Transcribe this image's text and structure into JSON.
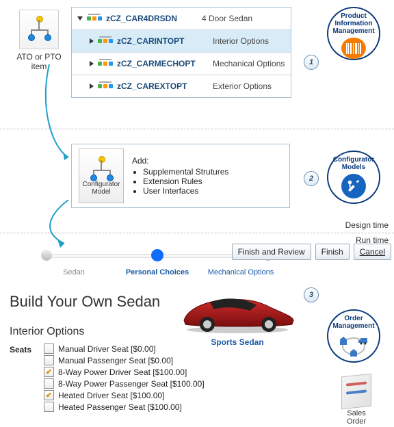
{
  "ato_label": "ATO or PTO\nitem",
  "item_tree": {
    "rows": [
      {
        "code": "zCZ_CAR4DRSDN",
        "desc": "4 Door Sedan",
        "expanded": true,
        "selected": false
      },
      {
        "code": "zCZ_CARINTOPT",
        "desc": "Interior Options",
        "expanded": false,
        "selected": true
      },
      {
        "code": "zCZ_CARMECHOPT",
        "desc": "Mechanical Options",
        "expanded": false,
        "selected": false
      },
      {
        "code": "zCZ_CAREXTOPT",
        "desc": "Exterior Options",
        "expanded": false,
        "selected": false
      }
    ]
  },
  "step_numbers": {
    "one": "1",
    "two": "2",
    "three": "3"
  },
  "circles": {
    "pim": "Product\nInformation\nManagement",
    "cm": "Configurator\nModels",
    "om": "Order\nManagement"
  },
  "configurator_box": {
    "icon_label": "Configurator\nModel",
    "heading": "Add:",
    "bullets": [
      "Supplemental Strutures",
      "Extension Rules",
      "User Interfaces"
    ]
  },
  "phase_labels": {
    "design": "Design time",
    "run": "Run time"
  },
  "runtime": {
    "steps": {
      "s1": "Sedan",
      "s2": "Personal Choices",
      "s3": "Mechanical Options"
    },
    "buttons": {
      "finish_review": "Finish and Review",
      "finish": "Finish",
      "cancel": "Cancel"
    },
    "title": "Build Your Own Sedan",
    "car_name": "Sports Sedan",
    "section": "Interior Options",
    "seats_label": "Seats",
    "seat_options": [
      {
        "label": "Manual Driver Seat [$0.00]",
        "checked": false
      },
      {
        "label": "Manual Passenger Seat [$0.00]",
        "checked": false
      },
      {
        "label": "8-Way Power Driver Seat [$100.00]",
        "checked": true
      },
      {
        "label": "8-Way Power Passenger Seat [$100.00]",
        "checked": false
      },
      {
        "label": "Heated Driver Seat [$100.00]",
        "checked": true
      },
      {
        "label": "Heated Passenger Seat [$100.00]",
        "checked": false
      }
    ]
  },
  "sales_order_label": "Sales\nOrder"
}
